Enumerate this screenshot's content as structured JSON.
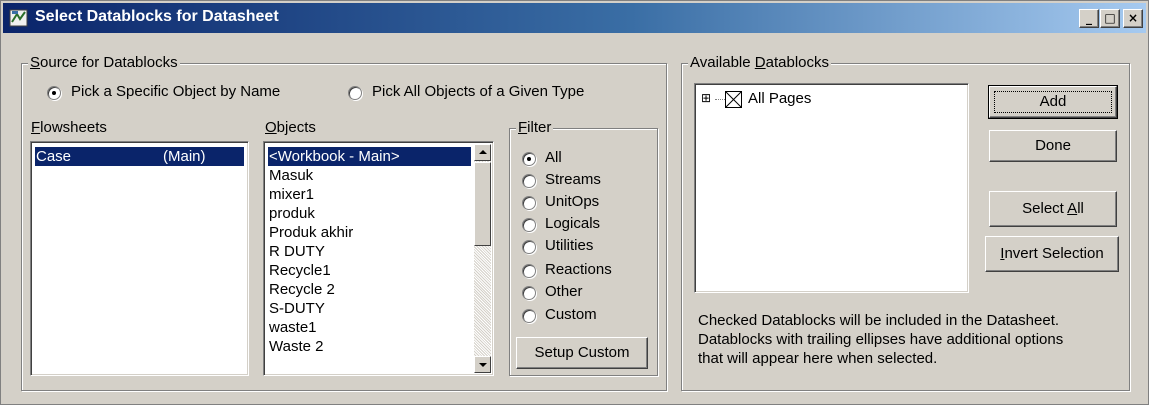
{
  "window": {
    "title": "Select Datablocks for Datasheet",
    "minimize": "_",
    "maximize": "□",
    "close": "×"
  },
  "source": {
    "legend_u": "S",
    "legend_rest": "ource for Datablocks",
    "radio_specific": "Pick a Specific Object by Name",
    "radio_all_type": "Pick All Objects of a Given Type",
    "selected_radio": "specific"
  },
  "flowsheets": {
    "label_u": "F",
    "label_rest": "lowsheets",
    "items": [
      {
        "name": "Case",
        "tag": "(Main)",
        "selected": true
      }
    ]
  },
  "objects": {
    "label_u": "O",
    "label_rest": "bjects",
    "items": [
      "<Workbook - Main>",
      "Masuk",
      "mixer1",
      "produk",
      "Produk akhir",
      "R DUTY",
      "Recycle1",
      "Recycle 2",
      "S-DUTY",
      "waste1",
      "Waste 2"
    ],
    "selected_index": 0
  },
  "filter": {
    "legend_u": "F",
    "legend_rest": "ilter",
    "options": [
      "All",
      "Streams",
      "UnitOps",
      "Logicals",
      "Utilities",
      "Reactions",
      "Other",
      "Custom"
    ],
    "selected_index": 0,
    "setup_custom_label": "Setup Custom"
  },
  "available": {
    "legend_pre": "Available ",
    "legend_u": "D",
    "legend_rest": "atablocks",
    "tree": [
      {
        "expander": "⊞",
        "label": "All Pages"
      }
    ],
    "info_text_lines": [
      "Checked Datablocks will be included in the Datasheet.",
      "Datablocks with trailing ellipses have additional options",
      "that will appear here when selected."
    ]
  },
  "buttons": {
    "add": "Add",
    "done": "Done",
    "select_all_pre": "Select ",
    "select_all_u": "A",
    "select_all_rest": "ll",
    "invert_u": "I",
    "invert_rest": "nvert Selection"
  },
  "colors": {
    "face": "#d4d0c8",
    "selection": "#0a246a",
    "title_start": "#0a246a",
    "title_end": "#a6caf0"
  }
}
